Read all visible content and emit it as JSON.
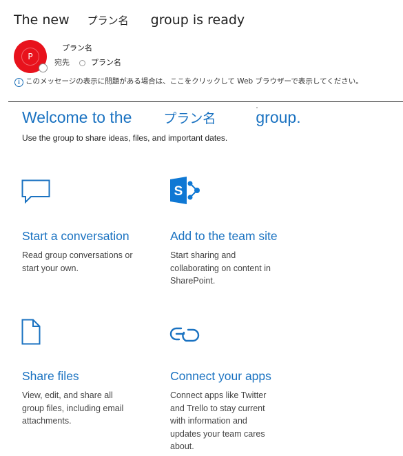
{
  "email": {
    "subject_prefix": "The new",
    "subject_plan": "プラン名",
    "subject_suffix": "group is ready",
    "avatar_initial": "P",
    "sender_name": "プラン名",
    "to_label": "宛先",
    "to_name": "プラン名",
    "info_notice": "このメッセージの表示に問題がある場合は、ここをクリックして Web ブラウザーで表示してください。"
  },
  "welcome": {
    "prefix": "Welcome to the",
    "plan": "プラン名",
    "suffix": "group.",
    "intro": "Use the group to share ideas, files, and important dates."
  },
  "tiles": {
    "conversation": {
      "icon": "chat-bubble-icon",
      "title": "Start a conversation",
      "desc_lines": [
        "Read group conversations or",
        "start your own."
      ]
    },
    "team_site": {
      "icon": "sharepoint-icon",
      "title": "Add to the team site",
      "desc_lines": [
        "Start sharing and",
        "collaborating on content in",
        "SharePoint."
      ]
    },
    "files": {
      "icon": "file-icon",
      "title": "Share files",
      "desc_lines": [
        "View, edit, and share all",
        "group files, including email",
        "attachments."
      ]
    },
    "apps": {
      "icon": "link-icon",
      "title": "Connect your apps",
      "desc_lines": [
        "Connect apps like Twitter",
        "and Trello to stay current",
        "with information and",
        "updates your team cares",
        "about."
      ]
    }
  },
  "colors": {
    "accent_blue": "#1a72c1",
    "avatar_red": "#e8121c",
    "sharepoint_blue": "#0f78d4"
  }
}
